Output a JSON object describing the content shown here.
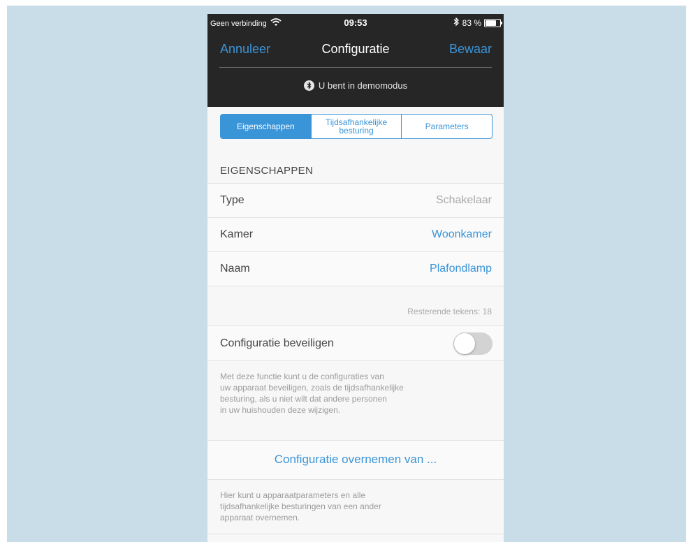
{
  "status_bar": {
    "carrier": "Geen verbinding",
    "time": "09:53",
    "battery_percent": "83 %",
    "battery_level": 0.83
  },
  "nav": {
    "cancel_label": "Annuleer",
    "title": "Configuratie",
    "save_label": "Bewaar"
  },
  "demo_banner": {
    "text": "U bent in demomodus",
    "icon": "bluetooth-icon"
  },
  "tabs": [
    {
      "label": "Eigenschappen",
      "selected": true
    },
    {
      "label": "Tijdsafhankelijke\nbesturing",
      "selected": false
    },
    {
      "label": "Parameters",
      "selected": false
    }
  ],
  "properties": {
    "section_title": "EIGENSCHAPPEN",
    "rows": [
      {
        "label": "Type",
        "value": "Schakelaar"
      },
      {
        "label": "Kamer",
        "value": "Woonkamer"
      },
      {
        "label": "Naam",
        "value": "Plafondlamp"
      }
    ],
    "remaining_chars": "Resterende tekens: 18"
  },
  "secure": {
    "label": "Configuratie beveiligen",
    "enabled": false,
    "description": "Met deze functie kunt u de configuraties van\nuw apparaat beveiligen, zoals de tijdsafhankelijke\nbesturing, als u niet wilt dat andere personen\nin uw huishouden deze wijzigen."
  },
  "copy_config": {
    "label": "Configuratie overnemen van ...",
    "description": "Hier kunt u apparaatparameters en alle\ntijdsafhankelijke besturingen van een ander\napparaat overnemen."
  },
  "colors": {
    "accent": "#3a94d8",
    "header_bg": "#262626",
    "page_bg": "#c8dde8"
  }
}
